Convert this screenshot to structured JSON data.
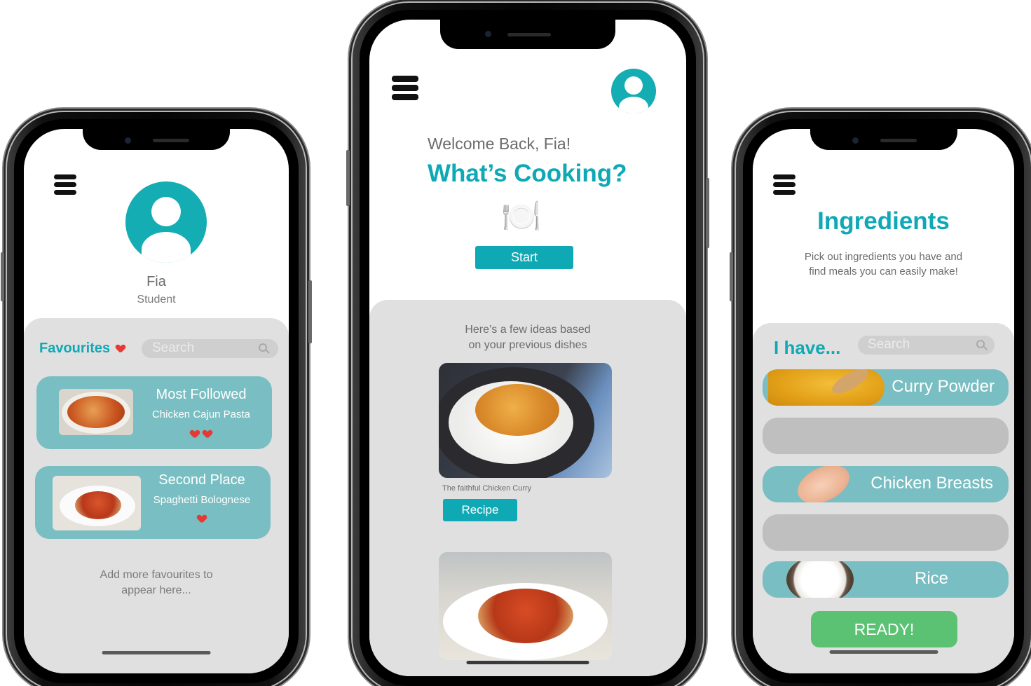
{
  "profile_screen": {
    "name": "Fia",
    "role": "Student",
    "favourites_title": "Favourites",
    "search_placeholder": "Search",
    "cards": [
      {
        "title": "Most Followed",
        "dish": "Chicken Cajun Pasta",
        "hearts": 2
      },
      {
        "title": "Second Place",
        "dish": "Spaghetti Bolognese",
        "hearts": 1
      }
    ],
    "add_more": [
      "Add more favourites to",
      "appear here..."
    ]
  },
  "home_screen": {
    "welcome": "Welcome Back, Fia!",
    "headline": "What’s Cooking?",
    "plate_icon": "🍽️",
    "start_label": "Start",
    "ideas_text": [
      "Here’s a few ideas based",
      "on your previous dishes"
    ],
    "recipe_caption": "The faithful Chicken Curry",
    "recipe_label": "Recipe"
  },
  "ingredients_screen": {
    "title": "Ingredients",
    "subtitle": [
      "Pick out ingredients you have and",
      "find meals you can easily make!"
    ],
    "i_have": "I have...",
    "search_placeholder": "Search",
    "items": [
      {
        "label": "Curry Powder",
        "selected": true
      },
      {
        "label": "",
        "selected": false
      },
      {
        "label": "Chicken Breasts",
        "selected": true
      },
      {
        "label": "",
        "selected": false
      },
      {
        "label": "Rice",
        "selected": true
      }
    ],
    "ready_label": "READY!"
  },
  "colors": {
    "accent": "#0fa9b5",
    "card": "#79bec2",
    "panel": "#e0e0e0",
    "ready": "#5cc273",
    "heart": "#e53935"
  }
}
